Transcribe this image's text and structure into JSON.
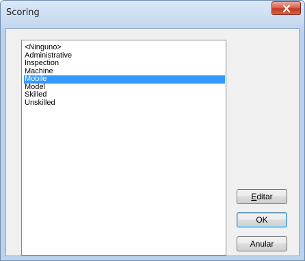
{
  "window": {
    "title": "Scoring"
  },
  "list": {
    "items": [
      "<Ninguno>",
      "Administrative",
      "Inspection",
      "Machine",
      "Mobile",
      "Model",
      "Skilled",
      "Unskilled"
    ],
    "selected_index": 4
  },
  "buttons": {
    "edit_mnemonic": "E",
    "edit_rest": "ditar",
    "ok": "OK",
    "cancel": "Anular"
  },
  "colors": {
    "selection": "#3399ff",
    "close_button": "#c4381e"
  },
  "icons": {
    "close": "close-icon"
  }
}
